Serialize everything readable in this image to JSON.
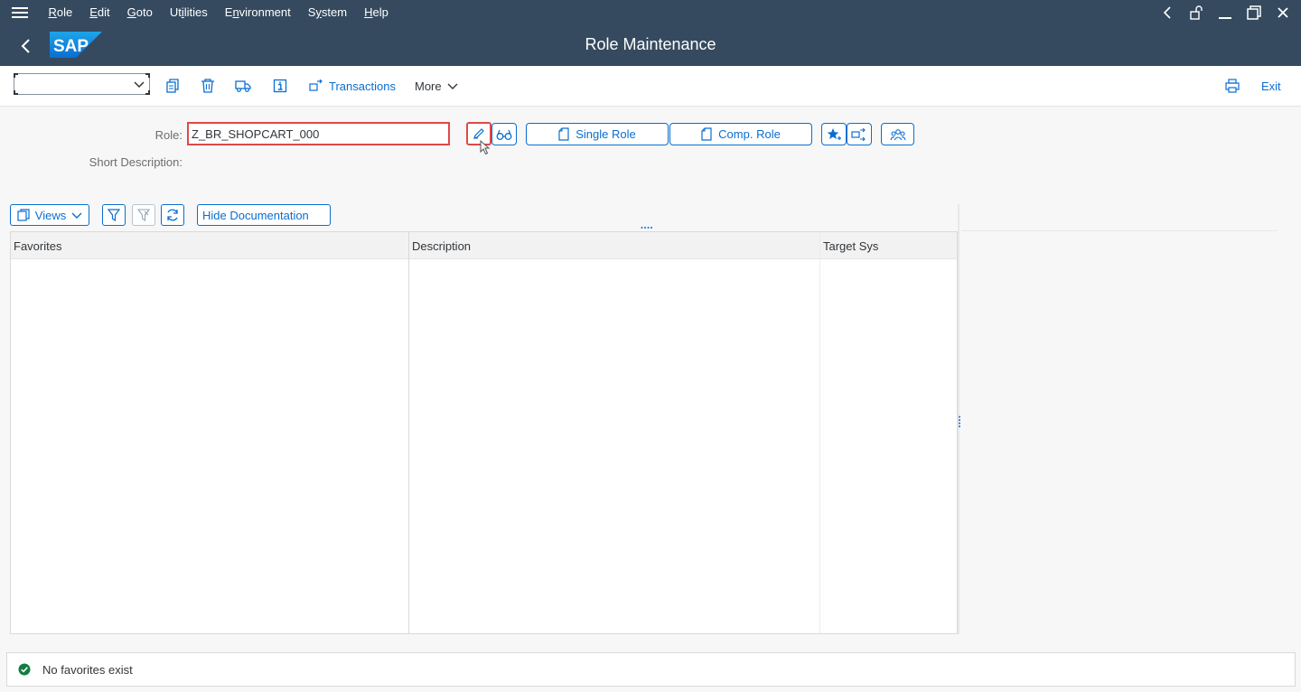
{
  "menubar": {
    "items": [
      "Role",
      "Edit",
      "Goto",
      "Utilities",
      "Environment",
      "System",
      "Help"
    ],
    "underline": [
      "R",
      "E",
      "G",
      "i",
      "n",
      "y",
      "H"
    ]
  },
  "header": {
    "title": "Role Maintenance",
    "logo_text": "SAP"
  },
  "toolbar": {
    "command_field_value": "",
    "transactions_label": "Transactions",
    "more_label": "More",
    "exit_label": "Exit"
  },
  "selection": {
    "role_label": "Role:",
    "role_value": "Z_BR_SHOPCART_000",
    "short_description_label": "Short Description:",
    "single_role_label": "Single Role",
    "comp_role_label": "Comp. Role"
  },
  "alv": {
    "views_label": "Views",
    "hide_documentation_label": "Hide Documentation",
    "columns": [
      "Favorites",
      "Description",
      "Target Sys"
    ]
  },
  "status": {
    "message": "No favorites exist",
    "type": "success",
    "color": "#107e3e"
  },
  "colors": {
    "shell": "#354a5f",
    "accent": "#0a6ed1",
    "highlight": "#e04848"
  }
}
